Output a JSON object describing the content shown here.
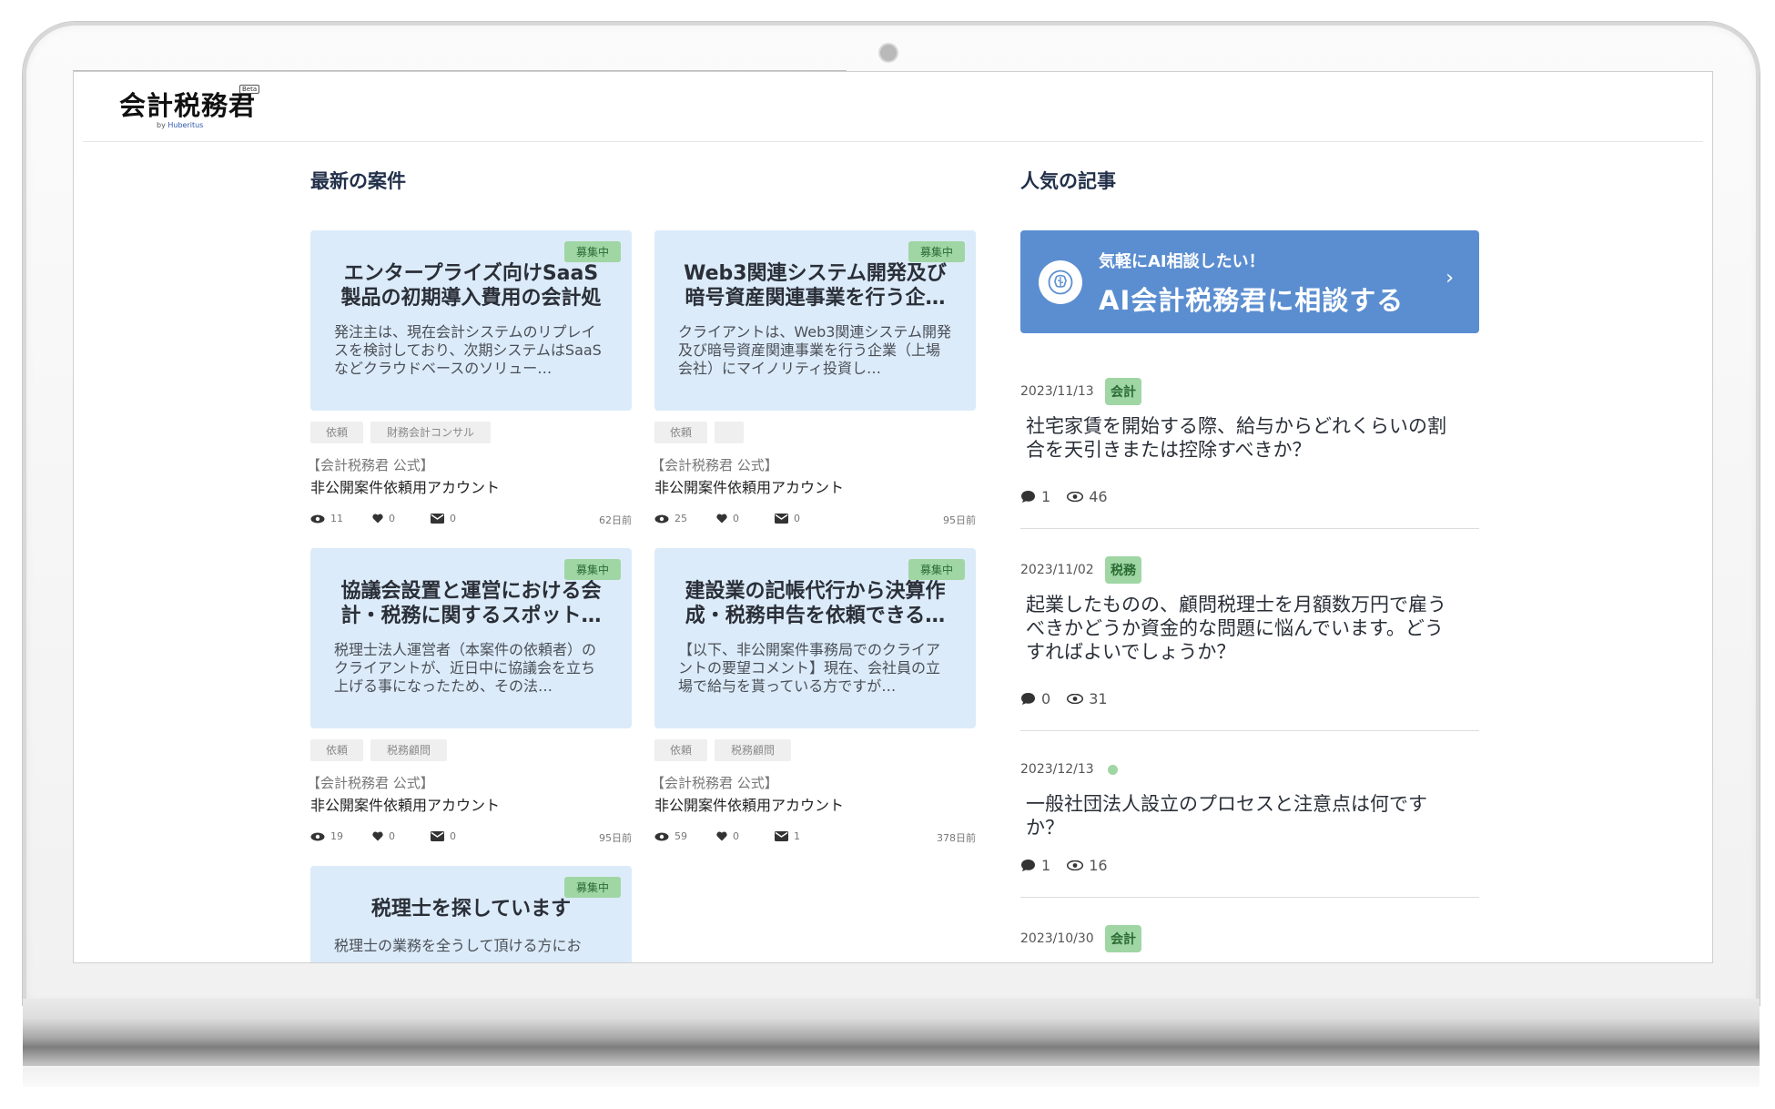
{
  "app": {
    "logo_text": "会計税務君",
    "logo_badge": "Beta",
    "logo_by": "by",
    "logo_company": "Huberitus"
  },
  "sections": {
    "latest_cases_title": "最新の案件",
    "popular_articles_title": "人気の記事"
  },
  "cases": [
    {
      "status": "募集中",
      "title": "エンタープライズ向けSaaS製品の初期導入費用の会計処理",
      "description": "発注主は、現在会計システムのリプレイスを検討しており、次期システムはSaaSなどクラウドベースのソリュー…",
      "tags": [
        "依頼",
        "財務会計コンサル"
      ],
      "author_sub": "【会計税務君 公式】",
      "author": "非公開案件依頼用アカウント",
      "views": "11",
      "likes": "0",
      "messages": "0",
      "age": "62日前"
    },
    {
      "status": "募集中",
      "title": "Web3関連システム開発及び暗号資産関連事業を行う企…",
      "description": "クライアントは、Web3関連システム開発及び暗号資産関連事業を行う企業（上場会社）にマイノリティ投資し…",
      "tags": [
        "依頼",
        ""
      ],
      "author_sub": "【会計税務君 公式】",
      "author": "非公開案件依頼用アカウント",
      "views": "25",
      "likes": "0",
      "messages": "0",
      "age": "95日前"
    },
    {
      "status": "募集中",
      "title": "協議会設置と運営における会計・税務に関するスポット…",
      "description": "税理士法人運営者（本案件の依頼者）のクライアントが、近日中に協議会を立ち上げる事になったため、その法…",
      "tags": [
        "依頼",
        "税務顧問"
      ],
      "author_sub": "【会計税務君 公式】",
      "author": "非公開案件依頼用アカウント",
      "views": "19",
      "likes": "0",
      "messages": "0",
      "age": "95日前"
    },
    {
      "status": "募集中",
      "title": "建設業の記帳代行から決算作成・税務申告を依頼できる…",
      "description": "【以下、非公開案件事務局でのクライアントの要望コメント】現在、会社員の立場で給与を貰っている方ですが…",
      "tags": [
        "依頼",
        "税務顧問"
      ],
      "author_sub": "【会計税務君 公式】",
      "author": "非公開案件依頼用アカウント",
      "views": "59",
      "likes": "0",
      "messages": "1",
      "age": "378日前"
    },
    {
      "status": "募集中",
      "title": "税理士を探しています",
      "description": "税理士の業務を全うして頂ける方にお",
      "tags": [],
      "author_sub": "",
      "author": "",
      "views": "",
      "likes": "",
      "messages": "",
      "age": ""
    }
  ],
  "ai_banner": {
    "subtitle": "気軽にAI相談したい！",
    "title": "AI会計税務君に相談する",
    "chevron": "›"
  },
  "articles": [
    {
      "date": "2023/11/13",
      "category": "会計",
      "title": "社宅家賃を開始する際、給与からどれくらいの割合を天引きまたは控除すべきか？",
      "comments": "1",
      "views": "46"
    },
    {
      "date": "2023/11/02",
      "category": "税務",
      "title": "起業したものの、顧問税理士を月額数万円で雇うべきかどうか資金的な問題に悩んでいます。どうすればよいでしょうか？",
      "comments": "0",
      "views": "31"
    },
    {
      "date": "2023/12/13",
      "category": "",
      "title": "一般社団法人設立のプロセスと注意点は何ですか？",
      "comments": "1",
      "views": "16"
    },
    {
      "date": "2023/10/30",
      "category": "会計",
      "title": "",
      "comments": "",
      "views": ""
    }
  ],
  "colors": {
    "card_bg": "#dcebf9",
    "badge_green": "#9fd6a4",
    "ai_banner_blue": "#5b8ed0"
  }
}
